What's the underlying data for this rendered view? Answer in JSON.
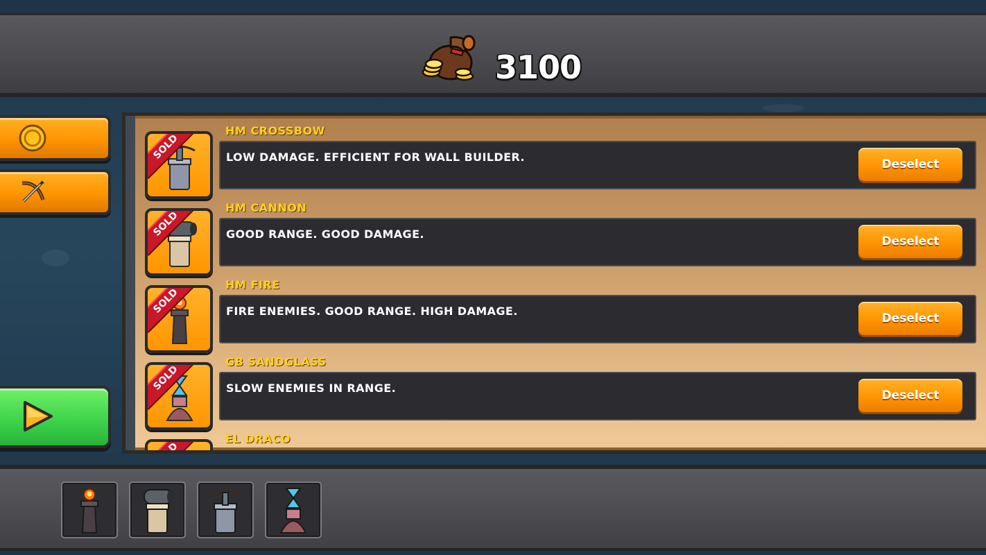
{
  "header": {
    "coin_icon": "coin-bag-icon",
    "coins": "3100"
  },
  "side_menu": {
    "items": [
      {
        "name": "coin-tab",
        "icon": "gold-coin-icon"
      },
      {
        "name": "crossbow-tab",
        "icon": "crossbow-icon"
      }
    ],
    "play_icon": "play-icon"
  },
  "towers": [
    {
      "title": "HM CROSSBOW",
      "description": "LOW DAMAGE. EFFICIENT FOR WALL BUILDER.",
      "badge": "SOLD",
      "button": "Deselect",
      "icon": "crossbow-tower-icon"
    },
    {
      "title": "HM CANNON",
      "description": "GOOD RANGE. GOOD DAMAGE.",
      "badge": "SOLD",
      "button": "Deselect",
      "icon": "cannon-tower-icon"
    },
    {
      "title": "HM FIRE",
      "description": "FIRE ENEMIES. GOOD RANGE. HIGH DAMAGE.",
      "badge": "SOLD",
      "button": "Deselect",
      "icon": "fire-tower-icon"
    },
    {
      "title": "GB SANDGLASS",
      "description": "SLOW ENEMIES IN RANGE.",
      "badge": "SOLD",
      "button": "Deselect",
      "icon": "sandglass-tower-icon"
    },
    {
      "title": "EL DRACO",
      "description": "",
      "badge": "SOLD",
      "button": "",
      "icon": "draco-tower-icon"
    }
  ],
  "selected_slots": [
    {
      "icon": "fire-tower-icon"
    },
    {
      "icon": "cannon-tower-icon"
    },
    {
      "icon": "crossbow-tower-icon"
    },
    {
      "icon": "sandglass-tower-icon"
    }
  ],
  "colors": {
    "accent_orange": "#ff9a00",
    "title_yellow": "#ffd21f",
    "sold_red": "#c8182a",
    "play_green": "#3fd44a"
  }
}
